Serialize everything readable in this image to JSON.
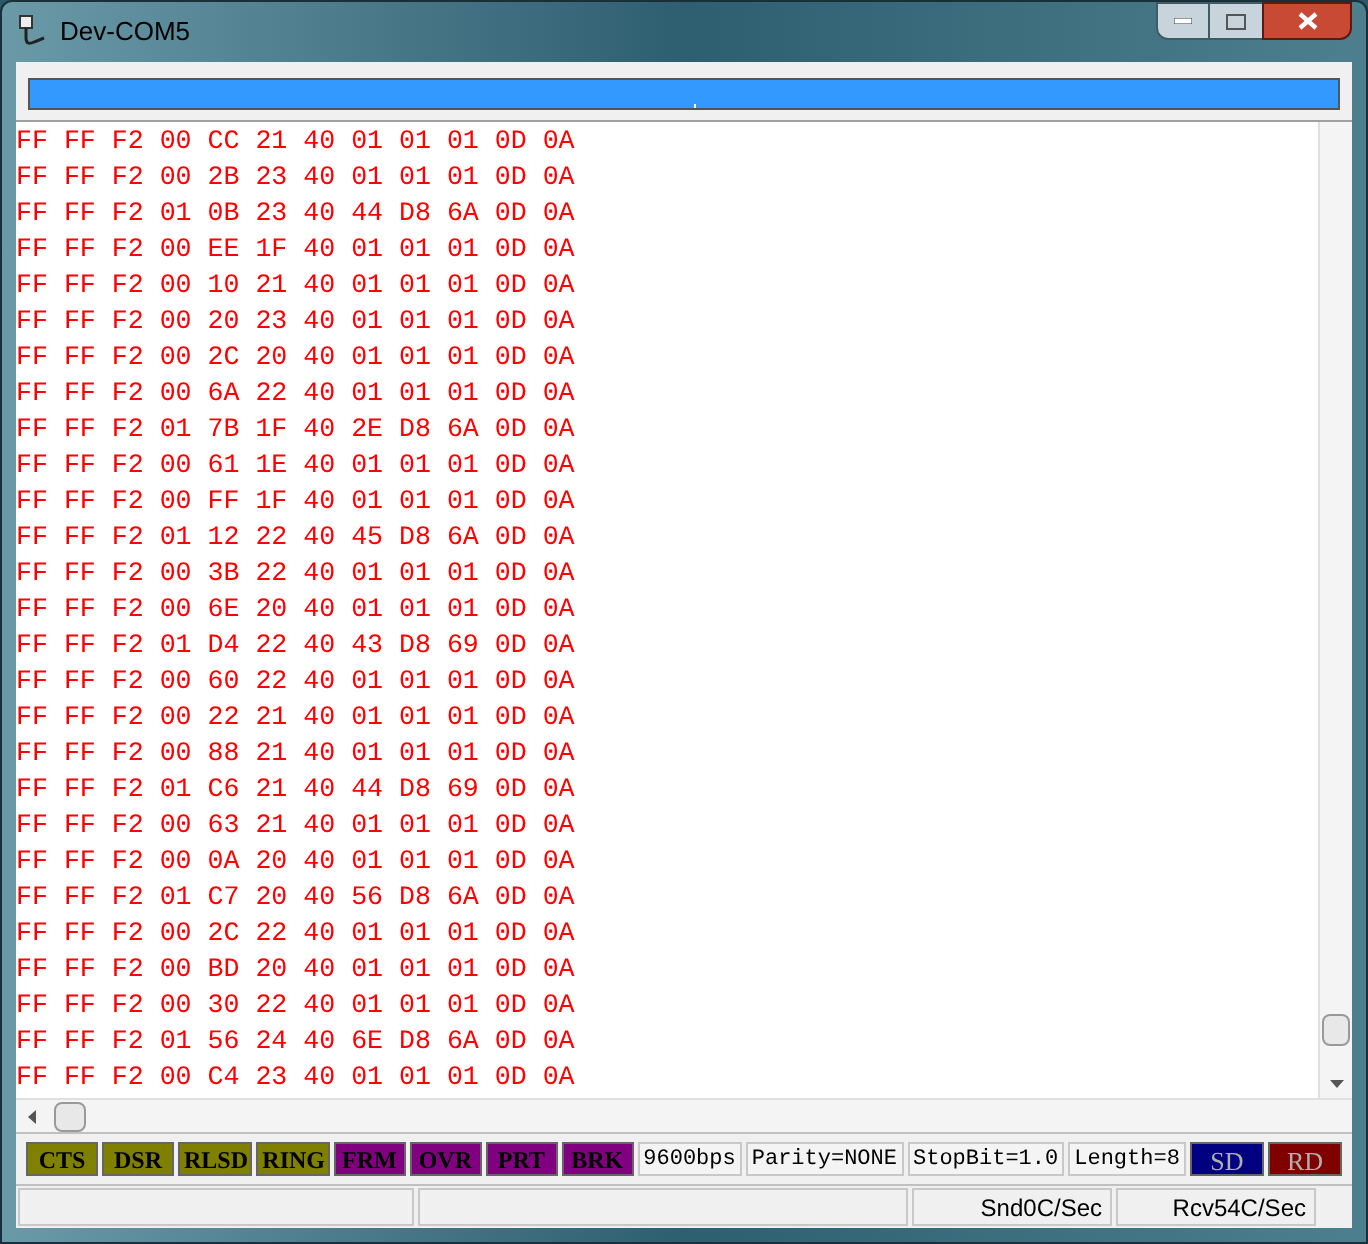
{
  "window": {
    "title": "Dev-COM5"
  },
  "lines": [
    "FF FF F2 00 CC 21 40 01 01 01 0D 0A",
    "FF FF F2 00 2B 23 40 01 01 01 0D 0A",
    "FF FF F2 01 0B 23 40 44 D8 6A 0D 0A",
    "FF FF F2 00 EE 1F 40 01 01 01 0D 0A",
    "FF FF F2 00 10 21 40 01 01 01 0D 0A",
    "FF FF F2 00 20 23 40 01 01 01 0D 0A",
    "FF FF F2 00 2C 20 40 01 01 01 0D 0A",
    "FF FF F2 00 6A 22 40 01 01 01 0D 0A",
    "FF FF F2 01 7B 1F 40 2E D8 6A 0D 0A",
    "FF FF F2 00 61 1E 40 01 01 01 0D 0A",
    "FF FF F2 00 FF 1F 40 01 01 01 0D 0A",
    "FF FF F2 01 12 22 40 45 D8 6A 0D 0A",
    "FF FF F2 00 3B 22 40 01 01 01 0D 0A",
    "FF FF F2 00 6E 20 40 01 01 01 0D 0A",
    "FF FF F2 01 D4 22 40 43 D8 69 0D 0A",
    "FF FF F2 00 60 22 40 01 01 01 0D 0A",
    "FF FF F2 00 22 21 40 01 01 01 0D 0A",
    "FF FF F2 00 88 21 40 01 01 01 0D 0A",
    "FF FF F2 01 C6 21 40 44 D8 69 0D 0A",
    "FF FF F2 00 63 21 40 01 01 01 0D 0A",
    "FF FF F2 00 0A 20 40 01 01 01 0D 0A",
    "FF FF F2 01 C7 20 40 56 D8 6A 0D 0A",
    "FF FF F2 00 2C 22 40 01 01 01 0D 0A",
    "FF FF F2 00 BD 20 40 01 01 01 0D 0A",
    "FF FF F2 00 30 22 40 01 01 01 0D 0A",
    "FF FF F2 01 56 24 40 6E D8 6A 0D 0A",
    "FF FF F2 00 C4 23 40 01 01 01 0D 0A"
  ],
  "indicators": [
    {
      "label": "CTS",
      "color": "#808000"
    },
    {
      "label": "DSR",
      "color": "#808000"
    },
    {
      "label": "RLSD",
      "color": "#808000"
    },
    {
      "label": "RING",
      "color": "#808000"
    },
    {
      "label": "FRM",
      "color": "#800080"
    },
    {
      "label": "OVR",
      "color": "#800080"
    },
    {
      "label": "PRT",
      "color": "#800080"
    },
    {
      "label": "BRK",
      "color": "#800080"
    }
  ],
  "settings": [
    "9600bps",
    "Parity=NONE",
    "StopBit=1.0",
    "Length=8"
  ],
  "lamps": [
    {
      "label": "SD",
      "color": "#000080"
    },
    {
      "label": "RD",
      "color": "#800000"
    }
  ],
  "status_bar": [
    "Snd0C/Sec",
    "Rcv54C/Sec"
  ]
}
